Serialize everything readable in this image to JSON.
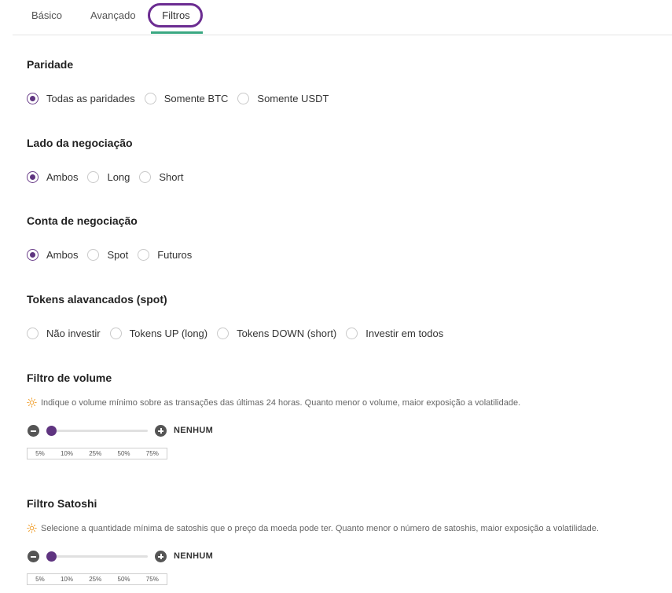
{
  "tabs": {
    "basic": "Básico",
    "advanced": "Avançado",
    "filters": "Filtros"
  },
  "accent_color": "#5f3480",
  "tab_underline_color": "#3aa882",
  "sections": {
    "pairing": {
      "title": "Paridade",
      "options": [
        "Todas as paridades",
        "Somente BTC",
        "Somente USDT"
      ],
      "selected": "Todas as paridades"
    },
    "side": {
      "title": "Lado da negociação",
      "options": [
        "Ambos",
        "Long",
        "Short"
      ],
      "selected": "Ambos"
    },
    "account": {
      "title": "Conta de negociação",
      "options": [
        "Ambos",
        "Spot",
        "Futuros"
      ],
      "selected": "Ambos"
    },
    "leveraged": {
      "title": "Tokens alavancados (spot)",
      "options": [
        "Não investir",
        "Tokens UP (long)",
        "Tokens DOWN (short)",
        "Investir em todos"
      ],
      "selected": ""
    },
    "volume": {
      "title": "Filtro de volume",
      "hint_icon": "lightbulb-icon",
      "hint": "Indique o volume mínimo sobre as transações das últimas 24 horas. Quanto menor o volume, maior exposição a volatilidade.",
      "value_label": "NENHUM",
      "level": 0,
      "presets": [
        "5%",
        "10%",
        "25%",
        "50%",
        "75%"
      ]
    },
    "satoshi": {
      "title": "Filtro Satoshi",
      "hint_icon": "lightbulb-icon",
      "hint": "Selecione a quantidade mínima de satoshis que o preço da moeda pode ter. Quanto menor o número de satoshis, maior exposição a volatilidade.",
      "value_label": "NENHUM",
      "level": 0,
      "presets": [
        "5%",
        "10%",
        "25%",
        "50%",
        "75%"
      ]
    }
  }
}
